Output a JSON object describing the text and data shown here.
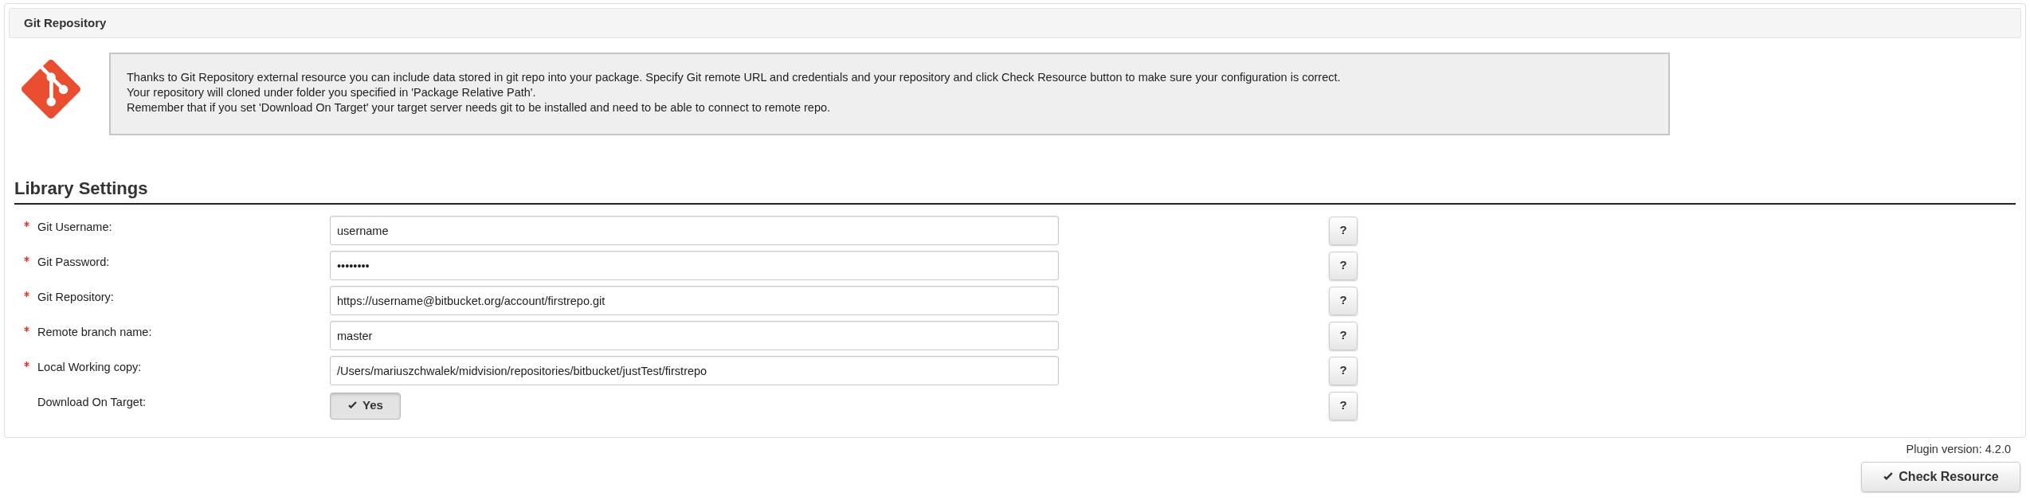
{
  "panel": {
    "title": "Git Repository"
  },
  "info": {
    "lines": [
      "Thanks to Git Repository external resource you can include data stored in git repo into your package. Specify Git remote URL and credentials and your repository and click Check Resource button to make sure your configuration is correct.",
      "Your repository will cloned under folder you specified in 'Package Relative Path'.",
      "Remember that if you set 'Download On Target' your target server needs git to be installed and need to be able to connect to remote repo."
    ]
  },
  "section": {
    "title": "Library Settings"
  },
  "fields": [
    {
      "kind": "text",
      "label": "Git Username:",
      "required": true,
      "value": "username",
      "help": "?"
    },
    {
      "kind": "text",
      "label": "Git Password:",
      "required": true,
      "value": "••••••••",
      "help": "?"
    },
    {
      "kind": "text",
      "label": "Git Repository:",
      "required": true,
      "value": "https://username@bitbucket.org/account/firstrepo.git",
      "help": "?"
    },
    {
      "kind": "text",
      "label": "Remote branch name:",
      "required": true,
      "value": "master",
      "help": "?"
    },
    {
      "kind": "text",
      "label": "Local Working copy:",
      "required": true,
      "value": "/Users/mariuszchwalek/midvision/repositories/bitbucket/justTest/firstrepo",
      "help": "?"
    },
    {
      "kind": "toggle",
      "label": "Download On Target:",
      "required": false,
      "value": "Yes",
      "on": true,
      "help": "?"
    }
  ],
  "footer": {
    "version": "Plugin version: 4.2.0",
    "button": "Check Resource"
  }
}
